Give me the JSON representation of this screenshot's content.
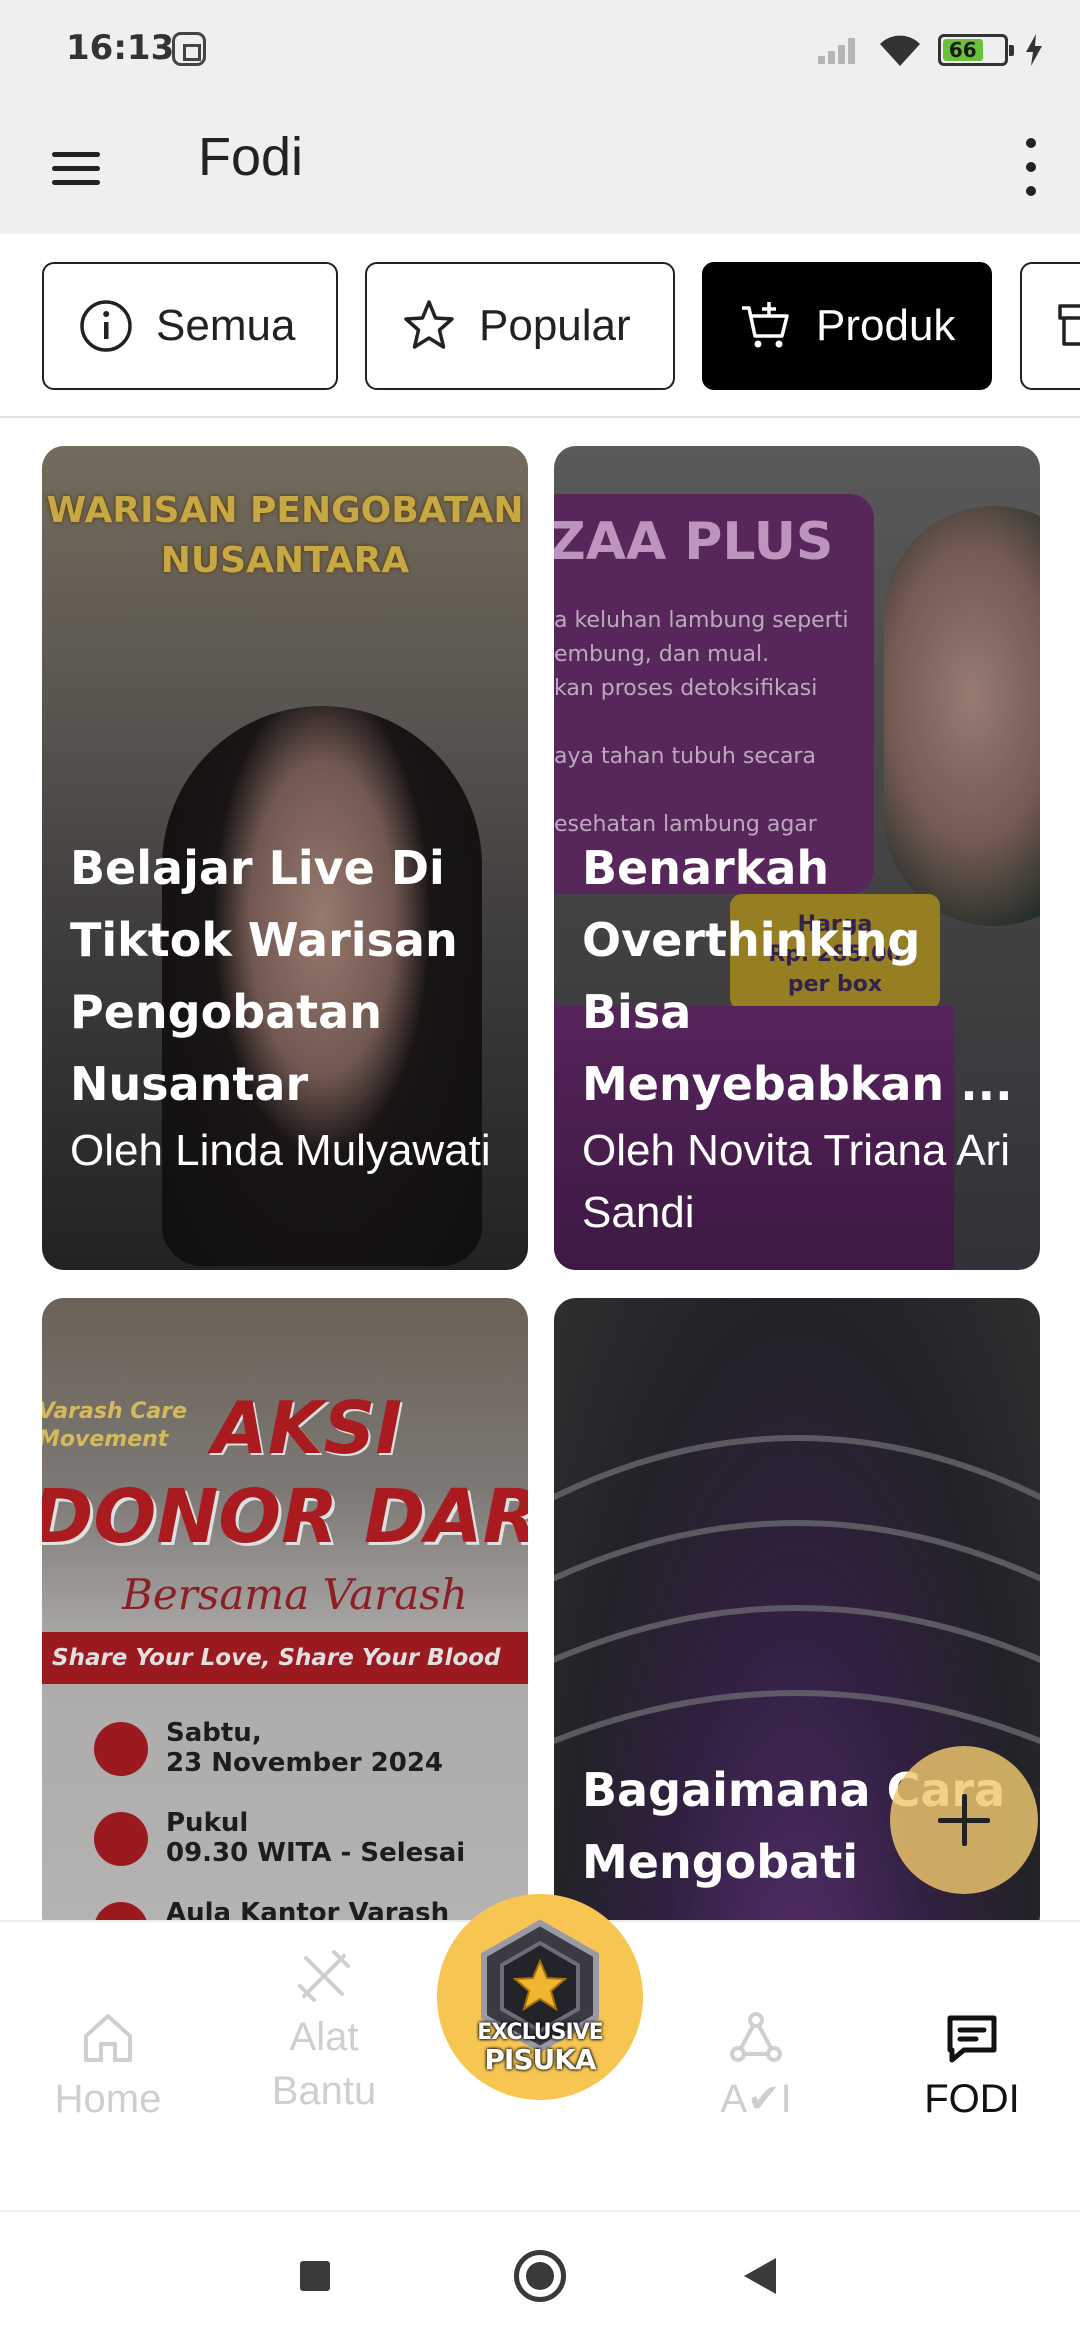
{
  "status_bar": {
    "time": "16:13",
    "battery_level": "66",
    "battery_color": "#69c23a"
  },
  "app_bar": {
    "title": "Fodi",
    "menu_icon": "hamburger-menu-icon",
    "overflow_icon": "more-vertical-icon"
  },
  "filters": [
    {
      "label": "Semua",
      "icon": "info-icon",
      "active": false
    },
    {
      "label": "Popular",
      "icon": "star-icon",
      "active": false
    },
    {
      "label": "Produk",
      "icon": "cart-plus-icon",
      "active": true
    },
    {
      "label": "",
      "icon": "store-icon",
      "active": false
    }
  ],
  "cards": [
    {
      "title": "Belajar Live Di Tiktok Warisan Pengobatan Nusantar",
      "author": "Oleh Linda Mulyawati",
      "poster_text": [
        "WARISAN PENGOBATAN",
        "NUSANTARA"
      ]
    },
    {
      "title": "Benarkah Overthinking Bisa Menyebabkan ...",
      "author": "Oleh Novita Triana Ari Sandi",
      "poster_text": [
        "ZAA PLUS",
        "a keluhan lambung seperti",
        "embung, dan mual.",
        "kan proses detoksifikasi",
        "aya tahan tubuh secara",
        "esehatan lambung agar",
        "Harga",
        "Rp. 285.00",
        "per box"
      ]
    },
    {
      "title": "",
      "author": "",
      "poster_text": [
        "Varash Care",
        "Movement",
        "AKSI",
        "DONOR DARAH",
        "Bersama Varash",
        "Share Your Love, Share Your Blood",
        "Sabtu,",
        "23 November 2024",
        "Pukul",
        "09.30 WITA - Selesai",
        "Aula Kantor Varash"
      ]
    },
    {
      "title": "Bagaimana Cara Mengobati",
      "author": "",
      "poster_text": []
    }
  ],
  "fab": {
    "icon": "plus-icon"
  },
  "bottom_nav": {
    "items": [
      {
        "label": "Home",
        "icon": "home-icon",
        "active": false
      },
      {
        "label": "Alat Bantu",
        "icon": "tools-icon",
        "active": false
      },
      {
        "label": "A✔I",
        "icon": "ai-network-icon",
        "active": false
      },
      {
        "label": "FODI",
        "icon": "chat-message-icon",
        "active": true
      }
    ],
    "center_badge": {
      "line1": "EXCLUSIVE",
      "line2": "PISUKA",
      "color": "#f7c552"
    }
  }
}
